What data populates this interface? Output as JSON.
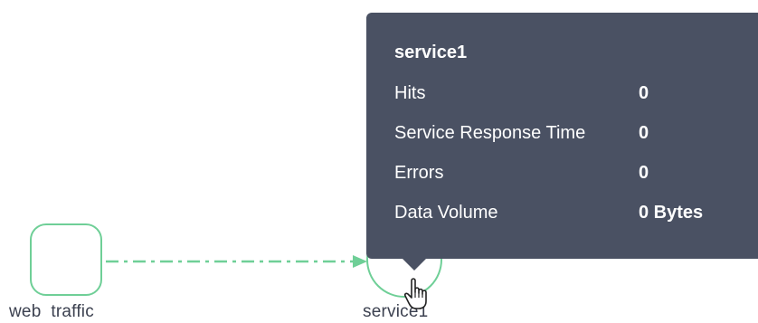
{
  "graph": {
    "nodes": [
      {
        "id": "web-traffic",
        "label": "web  traffic"
      },
      {
        "id": "service1",
        "label": "service1"
      }
    ],
    "edge": {
      "from": "web-traffic",
      "to": "service1"
    }
  },
  "tooltip": {
    "title": "service1",
    "metrics": [
      {
        "label": "Hits",
        "value": "0"
      },
      {
        "label": "Service Response Time",
        "value": "0"
      },
      {
        "label": "Errors",
        "value": "0"
      },
      {
        "label": "Data Volume",
        "value": "0 Bytes"
      }
    ]
  },
  "colors": {
    "node_border": "#6fcf97",
    "edge": "#6fcf97",
    "tooltip_bg": "#4a5163",
    "label_text": "#3c4150"
  },
  "icons": {
    "cursor": "hand-pointer-icon"
  }
}
